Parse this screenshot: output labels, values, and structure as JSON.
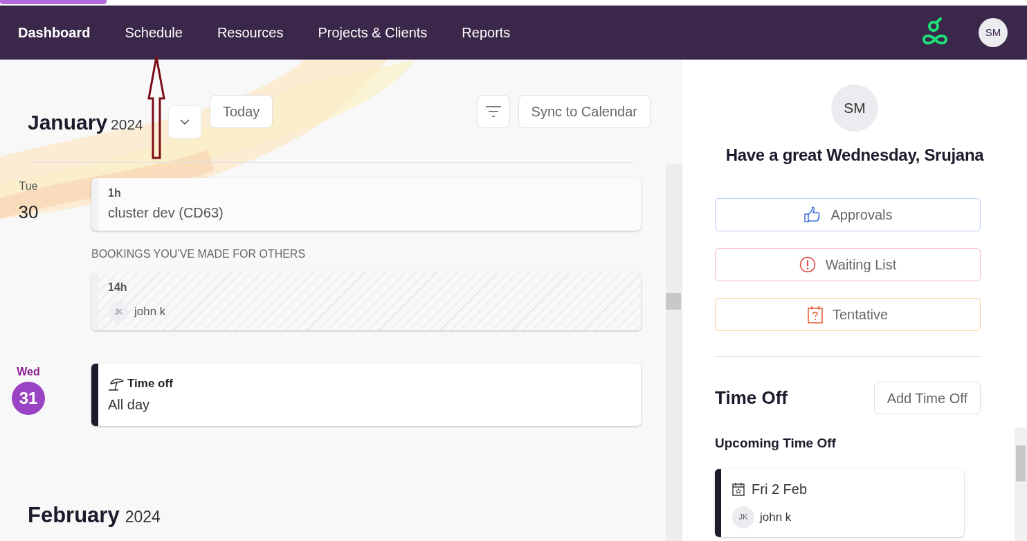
{
  "nav": {
    "items": [
      {
        "label": "Dashboard",
        "selected": true
      },
      {
        "label": "Schedule",
        "selected": false
      },
      {
        "label": "Resources",
        "selected": false
      },
      {
        "label": "Projects & Clients",
        "selected": false
      },
      {
        "label": "Reports",
        "selected": false
      }
    ],
    "avatar": "SM"
  },
  "calendar": {
    "month": "January",
    "year": "2024",
    "today_button": "Today",
    "sync_button": "Sync to Calendar",
    "days": [
      {
        "weekday": "Tue",
        "day": "30",
        "today": false,
        "entries": [
          {
            "kind": "booking",
            "hours": "1h",
            "title": "cluster dev (CD63)"
          },
          {
            "kind": "heading",
            "text": "BOOKINGS YOU’VE MADE FOR OTHERS"
          },
          {
            "kind": "others",
            "hours": "14h",
            "initials": "JK",
            "name": "john k"
          }
        ]
      },
      {
        "weekday": "Wed",
        "day": "31",
        "today": true,
        "entries": [
          {
            "kind": "time_off",
            "title": "Time off",
            "detail": "All day"
          }
        ]
      }
    ],
    "next_month": {
      "month": "February",
      "year": "2024"
    }
  },
  "side": {
    "avatar": "SM",
    "greeting": "Have a great Wednesday, Srujana",
    "actions": [
      {
        "kind": "approvals",
        "label": "Approvals"
      },
      {
        "kind": "waiting",
        "label": "Waiting List"
      },
      {
        "kind": "tentative",
        "label": "Tentative"
      }
    ],
    "time_off": {
      "title": "Time Off",
      "add_button": "Add Time Off",
      "upcoming_title": "Upcoming Time Off",
      "items": [
        {
          "date": "Fri 2 Feb",
          "initials": "JK",
          "name": "john k"
        }
      ]
    }
  }
}
